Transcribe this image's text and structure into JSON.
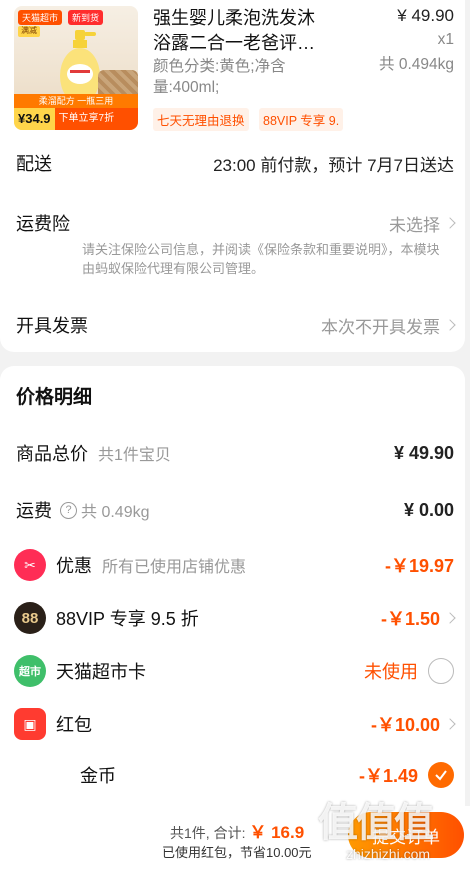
{
  "product": {
    "thumb": {
      "tag_store": "天猫超市",
      "tag_new": "新到货",
      "tag_promo": "满减",
      "promo_text": "柔溜配方 一瓶三用",
      "price": "¥34.9",
      "price_desc": "下单立享7折"
    },
    "title_line1": "强生婴儿柔泡洗发沐",
    "title_line2": "浴露二合一老爸评…",
    "spec": "颜色分类:黄色;净含量:400ml;",
    "price": "¥ 49.90",
    "qty": "x1",
    "weight": "共 0.494kg",
    "badges": [
      "七天无理由退换",
      "88VIP 专享 9."
    ]
  },
  "delivery": {
    "label": "配送",
    "value": "23:00 前付款，预计 7月7日送达"
  },
  "insurance": {
    "label": "运费险",
    "value": "未选择",
    "note": "请关注保险公司信息，并阅读《保险条款和重要说明》，本模块由蚂蚁保险代理有限公司管理。"
  },
  "invoice": {
    "label": "开具发票",
    "value": "本次不开具发票"
  },
  "price_detail": {
    "title": "价格明细",
    "goods_total": {
      "label": "商品总价",
      "sub": "共1件宝贝",
      "amount": "¥ 49.90"
    },
    "shipping": {
      "label": "运费",
      "sub": "共 0.49kg",
      "amount": "¥ 0.00"
    },
    "discount": {
      "label": "优惠",
      "sub": "所有已使用店铺优惠",
      "amount": "-￥19.97"
    },
    "vip": {
      "label": "88VIP 专享 9.5 折",
      "amount": "-￥1.50",
      "icon_text": "88"
    },
    "supermarket_card": {
      "label": "天猫超市卡",
      "amount": "未使用",
      "icon_text": "超市"
    },
    "red_packet": {
      "label": "红包",
      "amount": "-￥10.00"
    },
    "coins": {
      "label": "金币",
      "amount": "-￥1.49"
    }
  },
  "footer": {
    "count": "共1件,",
    "total_label": "合计:",
    "total_value": "￥ 16.9",
    "saved": "已使用红包，节省10.00元",
    "submit": "提交订单"
  },
  "watermark": {
    "main": "值值值",
    "sub": "zhizhizhi.com"
  },
  "colors": {
    "accent": "#ff5000",
    "muted": "#999999",
    "background": "#f2f2f2"
  }
}
